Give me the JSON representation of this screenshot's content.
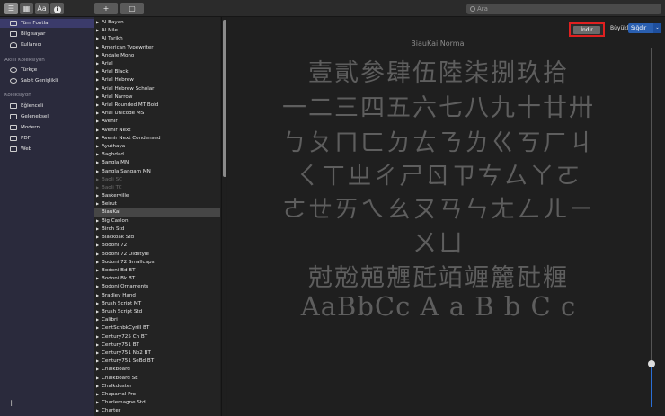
{
  "toolbar": {
    "sidebar_toggle": "☰",
    "grid_view": "▦",
    "sample_view": "Aa",
    "info_button": "i",
    "add_button": "+",
    "window_button": "▢",
    "search_placeholder": "Ara"
  },
  "sidebar": {
    "library_items": [
      {
        "label": "Tüm Fontlar",
        "icon": "fonts-icon"
      },
      {
        "label": "Bilgisayar",
        "icon": "computer-icon"
      },
      {
        "label": "Kullanıcı",
        "icon": "user-icon"
      }
    ],
    "smart_heading": "Akıllı Koleksiyon",
    "smart_items": [
      {
        "label": "Türkçe",
        "icon": "gear-icon"
      },
      {
        "label": "Sabit Genişlikli",
        "icon": "gear-icon"
      }
    ],
    "collection_heading": "Koleksiyon",
    "collection_items": [
      {
        "label": "Eğlenceli",
        "icon": "collection-icon"
      },
      {
        "label": "Geleneksel",
        "icon": "collection-icon"
      },
      {
        "label": "Modern",
        "icon": "collection-icon"
      },
      {
        "label": "PDF",
        "icon": "collection-icon"
      },
      {
        "label": "Web",
        "icon": "collection-icon"
      }
    ],
    "add_label": "+"
  },
  "fonts": [
    {
      "name": "Al Bayan",
      "arrow": true
    },
    {
      "name": "Al Nile",
      "arrow": true
    },
    {
      "name": "Al Tarikh",
      "arrow": true
    },
    {
      "name": "American Typewriter",
      "arrow": true
    },
    {
      "name": "Andale Mono",
      "arrow": true
    },
    {
      "name": "Arial",
      "arrow": true
    },
    {
      "name": "Arial Black",
      "arrow": true
    },
    {
      "name": "Arial Hebrew",
      "arrow": true
    },
    {
      "name": "Arial Hebrew Scholar",
      "arrow": true
    },
    {
      "name": "Arial Narrow",
      "arrow": true
    },
    {
      "name": "Arial Rounded MT Bold",
      "arrow": true
    },
    {
      "name": "Arial Unicode MS",
      "arrow": true
    },
    {
      "name": "Avenir",
      "arrow": true
    },
    {
      "name": "Avenir Next",
      "arrow": true
    },
    {
      "name": "Avenir Next Condensed",
      "arrow": true
    },
    {
      "name": "Ayuthaya",
      "arrow": true
    },
    {
      "name": "Baghdad",
      "arrow": true
    },
    {
      "name": "Bangla MN",
      "arrow": true
    },
    {
      "name": "Bangla Sangam MN",
      "arrow": true
    },
    {
      "name": "Baoli SC",
      "arrow": true,
      "disabled": true
    },
    {
      "name": "Baoli TC",
      "arrow": true,
      "disabled": true
    },
    {
      "name": "Baskerville",
      "arrow": true
    },
    {
      "name": "Beirut",
      "arrow": true
    },
    {
      "name": "BiauKai",
      "arrow": false,
      "selected": true
    },
    {
      "name": "Big Caslon",
      "arrow": true
    },
    {
      "name": "Birch Std",
      "arrow": true
    },
    {
      "name": "Blackoak Std",
      "arrow": true
    },
    {
      "name": "Bodoni 72",
      "arrow": true
    },
    {
      "name": "Bodoni 72 Oldstyle",
      "arrow": true
    },
    {
      "name": "Bodoni 72 Smallcaps",
      "arrow": true
    },
    {
      "name": "Bodoni Bd BT",
      "arrow": true
    },
    {
      "name": "Bodoni Bk BT",
      "arrow": true
    },
    {
      "name": "Bodoni Ornaments",
      "arrow": true
    },
    {
      "name": "Bradley Hand",
      "arrow": true
    },
    {
      "name": "Brush Script MT",
      "arrow": true
    },
    {
      "name": "Brush Script Std",
      "arrow": true
    },
    {
      "name": "Calibri",
      "arrow": true
    },
    {
      "name": "CentSchbkCyrill BT",
      "arrow": true
    },
    {
      "name": "Century725 Cn BT",
      "arrow": true
    },
    {
      "name": "Century751 BT",
      "arrow": true
    },
    {
      "name": "Century751 No2 BT",
      "arrow": true
    },
    {
      "name": "Century751 SeBd BT",
      "arrow": true
    },
    {
      "name": "Chalkboard",
      "arrow": true
    },
    {
      "name": "Chalkboard SE",
      "arrow": true
    },
    {
      "name": "Chalkduster",
      "arrow": true
    },
    {
      "name": "Chaparral Pro",
      "arrow": true
    },
    {
      "name": "Charlemagne Std",
      "arrow": true
    },
    {
      "name": "Charter",
      "arrow": true
    }
  ],
  "preview": {
    "download_label": "İndir",
    "size_label": "Büyüklük:",
    "size_value": "Sığdır",
    "font_name": "BiauKai Normal",
    "lines": [
      "壹貳參肆伍陸柒捌玖拾",
      "一二三四五六七八九十廿卅",
      "ㄅㄆㄇㄈㄉㄊㄋㄌㄍㄎㄏㄐ",
      "ㄑㄒㄓㄔㄕㄖㄗㄘㄙㄚㄛ",
      "ㄜㄝㄞㄟㄠㄡㄢㄣㄤㄥㄦㄧ",
      "ㄨㄩ",
      "尅兝兡兣瓩竡竰籭瓧糎",
      "AaBbCc A a B b C c"
    ],
    "size_level": 0.12
  }
}
